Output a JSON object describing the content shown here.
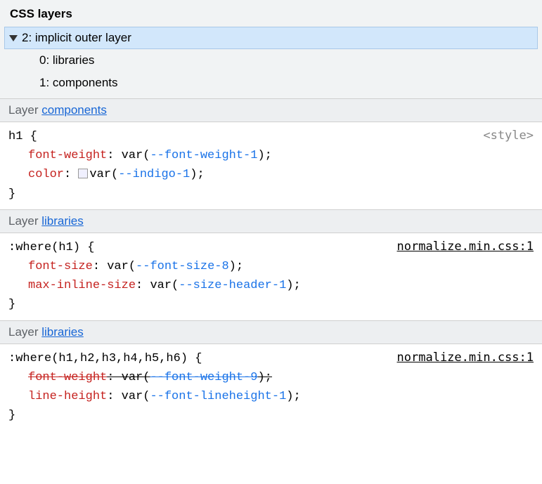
{
  "header": "CSS layers",
  "tree": {
    "root": "2: implicit outer layer",
    "children": [
      "0: libraries",
      "1: components"
    ]
  },
  "layer_word": "Layer ",
  "rules": [
    {
      "layer_link": "components",
      "selector": "h1 {",
      "source": "<style>",
      "source_link": false,
      "decls": [
        {
          "prop": "font-weight",
          "var": "--font-weight-1",
          "swatch": false,
          "strike": false
        },
        {
          "prop": "color",
          "var": "--indigo-1",
          "swatch": true,
          "strike": false
        }
      ]
    },
    {
      "layer_link": "libraries",
      "selector": ":where(h1) {",
      "source": "normalize.min.css:1",
      "source_link": true,
      "decls": [
        {
          "prop": "font-size",
          "var": "--font-size-8",
          "swatch": false,
          "strike": false
        },
        {
          "prop": "max-inline-size",
          "var": "--size-header-1",
          "swatch": false,
          "strike": false
        }
      ]
    },
    {
      "layer_link": "libraries",
      "selector": ":where(h1,h2,h3,h4,h5,h6) {",
      "source": "normalize.min.css:1",
      "source_link": true,
      "decls": [
        {
          "prop": "font-weight",
          "var": "--font-weight-9",
          "swatch": false,
          "strike": true
        },
        {
          "prop": "line-height",
          "var": "--font-lineheight-1",
          "swatch": false,
          "strike": false
        }
      ]
    }
  ],
  "close_brace": "}",
  "var_open": "var(",
  "var_close": ");",
  "colon_sp": ": "
}
